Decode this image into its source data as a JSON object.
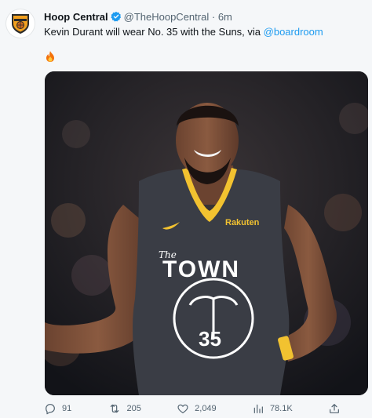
{
  "tweet": {
    "author_name": "Hoop Central",
    "handle": "@TheHoopCentral",
    "separator": "·",
    "time": "6m",
    "text_before": "Kevin Durant will wear No. 35 with the Suns, via ",
    "mention": "@boardroom",
    "emoji": "🔥",
    "media": {
      "jersey_brand": "Rakuten",
      "jersey_script": "The",
      "jersey_word": "TOWN",
      "jersey_number": "35"
    },
    "stats": {
      "replies": "91",
      "retweets": "205",
      "likes": "2,049",
      "views": "78.1K"
    }
  },
  "colors": {
    "link": "#1d9bf0",
    "verified": "#1d9bf0",
    "text": "#0f1419",
    "muted": "#536471",
    "jersey": "#3a3d45",
    "jersey_trim": "#f2c230"
  },
  "icons": [
    "avatar-logo-icon",
    "verified-badge-icon",
    "fire-emoji-icon",
    "reply-icon",
    "retweet-icon",
    "like-icon",
    "views-icon",
    "share-icon"
  ]
}
